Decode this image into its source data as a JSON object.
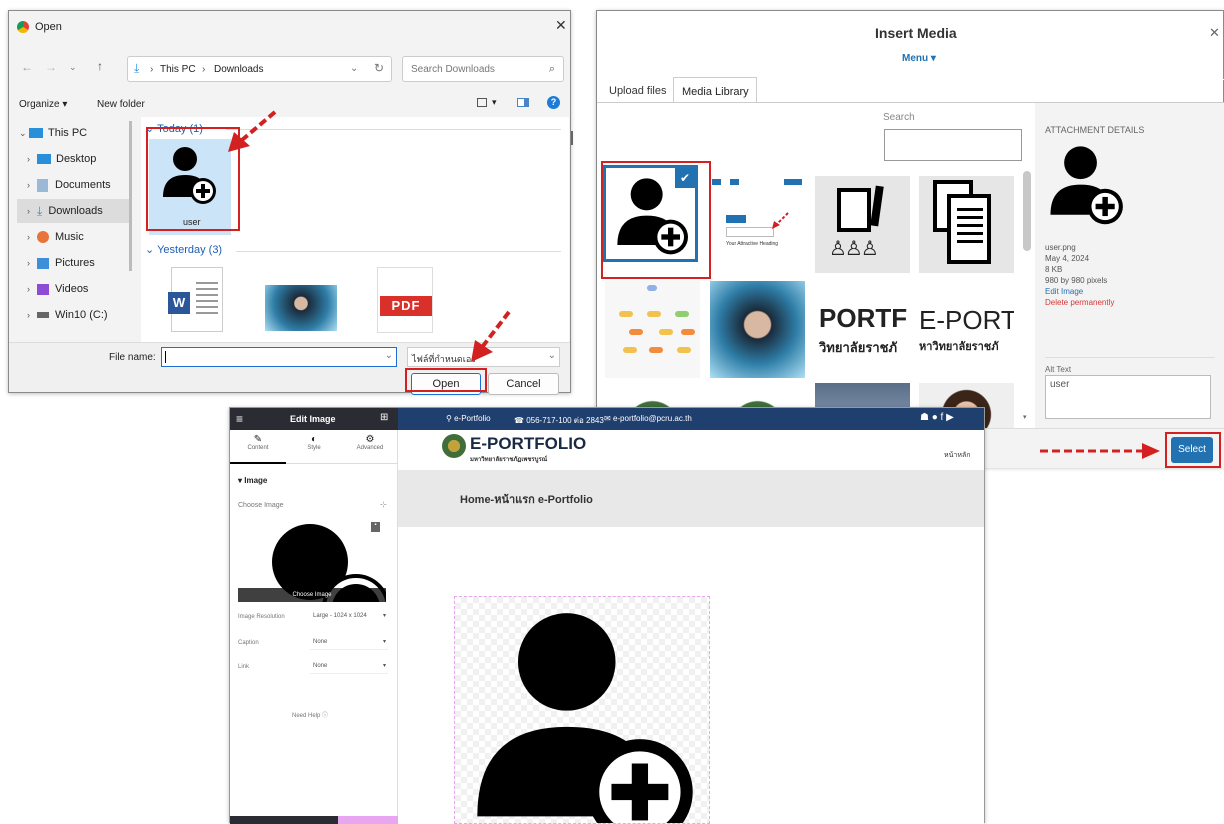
{
  "open_dialog": {
    "title": "Open",
    "address": {
      "part1": "This PC",
      "part2": "Downloads"
    },
    "search_placeholder": "Search Downloads",
    "organize_label": "Organize ▾",
    "new_folder_label": "New folder",
    "nav_items": [
      {
        "label": "This PC",
        "icon": "pc-icon"
      },
      {
        "label": "Desktop",
        "icon": "desktop-icon"
      },
      {
        "label": "Documents",
        "icon": "documents-icon"
      },
      {
        "label": "Downloads",
        "icon": "downloads-icon"
      },
      {
        "label": "Music",
        "icon": "music-icon"
      },
      {
        "label": "Pictures",
        "icon": "pictures-icon"
      },
      {
        "label": "Videos",
        "icon": "videos-icon"
      },
      {
        "label": "Win10 (C:)",
        "icon": "drive-icon"
      }
    ],
    "group_today": "Today (1)",
    "group_yesterday": "Yesterday (3)",
    "file_user_label": "user",
    "file_name_label": "File name:",
    "file_name_value": "",
    "file_type_value": "ไฟล์ที่กำหนดเอง",
    "open_button": "Open",
    "cancel_button": "Cancel",
    "pdf_label": "PDF",
    "word_label": "W"
  },
  "media_dialog": {
    "title": "Insert Media",
    "menu_label": "Menu ▾",
    "tabs": [
      "Upload files",
      "Media Library"
    ],
    "search_label": "Search",
    "details_header": "ATTACHMENT DETAILS",
    "details": {
      "filename": "user.png",
      "date": "May 4, 2024",
      "size": "8 KB",
      "dimensions": "980 by 980 pixels",
      "edit_link": "Edit Image",
      "delete_link": "Delete permanently"
    },
    "alt_text_label": "Alt Text",
    "alt_text_value": "user",
    "select_button": "Select",
    "portf_label_a": "PORTF",
    "portf_label_b": "E-PORTF",
    "thai_text_a": "วิทยาลัยราชภั",
    "thai_text_b": "หาวิทยาลัยราชภั",
    "mini_label": "Your Attractive Heading"
  },
  "editor": {
    "header_title": "Edit Image",
    "tabs": [
      "Content",
      "Style",
      "Advanced"
    ],
    "section_label": "Image",
    "choose_image_label": "Choose Image",
    "choose_image_overlay": "Choose Image",
    "fields": [
      {
        "label": "Image Resolution",
        "value": "Large - 1024 x 1024"
      },
      {
        "label": "Caption",
        "value": "None"
      },
      {
        "label": "Link",
        "value": "None"
      }
    ],
    "help_label": "Need Help",
    "topbar": {
      "site": "e-Portfolio",
      "phone": "056-717-100 ต่อ 2843",
      "email": "e-portfolio@pcru.ac.th"
    },
    "brand_title": "E-PORTFOLIO",
    "brand_subtitle": "มหาวิทยาลัยราชภัฏเพชรบูรณ์",
    "nav_home": "หน้าหลัก",
    "page_title": "Home-หน้าแรก e-Portfolio"
  },
  "colors": {
    "red_highlight": "#d32020",
    "wp_blue": "#2271b1",
    "elementor_dark": "#2b2b33",
    "site_bar": "#1f3f6e"
  }
}
